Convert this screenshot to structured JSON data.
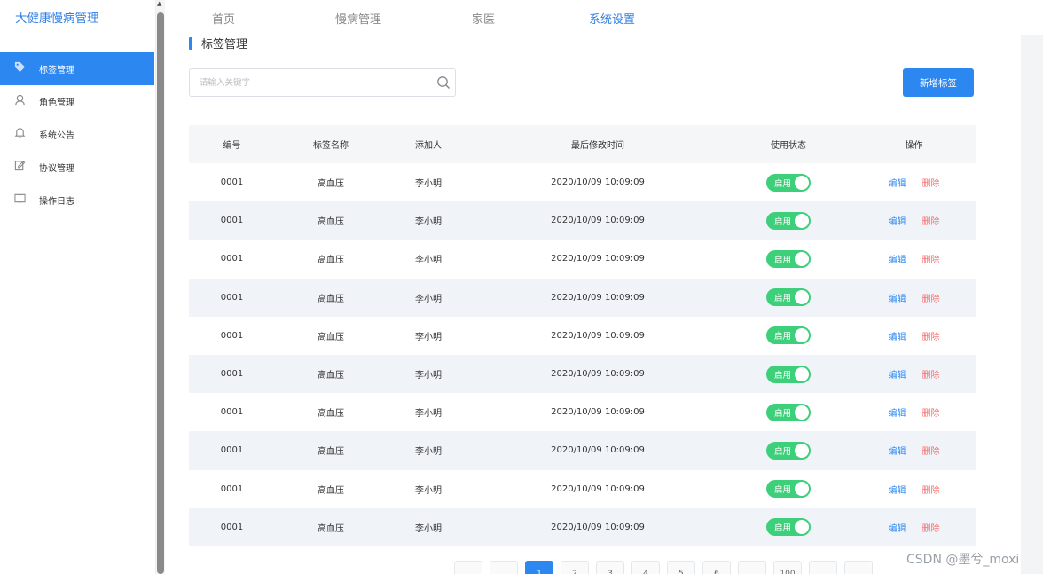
{
  "app": {
    "brand": "大健康慢病管理"
  },
  "topnav": [
    {
      "label": "首页"
    },
    {
      "label": "慢病管理"
    },
    {
      "label": "家医"
    },
    {
      "label": "系统设置",
      "active": true
    }
  ],
  "sidebar": {
    "items": [
      {
        "label": "标签管理",
        "icon": "tag-icon",
        "active": true
      },
      {
        "label": "角色管理",
        "icon": "user-icon"
      },
      {
        "label": "系统公告",
        "icon": "bell-icon"
      },
      {
        "label": "协议管理",
        "icon": "edit-document-icon"
      },
      {
        "label": "操作日志",
        "icon": "book-icon"
      }
    ]
  },
  "page": {
    "title": "标签管理",
    "search_placeholder": "请输入关键字",
    "add_button": "新增标签"
  },
  "table": {
    "headers": [
      "编号",
      "标签名称",
      "添加人",
      "最后修改时间",
      "使用状态",
      "操作"
    ],
    "rows": [
      {
        "id": "0001",
        "name": "高血压",
        "creator": "李小明",
        "modified": "2020/10/09 10:09:09",
        "status": "启用",
        "edit": "编辑",
        "delete": "删除"
      },
      {
        "id": "0001",
        "name": "高血压",
        "creator": "李小明",
        "modified": "2020/10/09 10:09:09",
        "status": "启用",
        "edit": "编辑",
        "delete": "删除"
      },
      {
        "id": "0001",
        "name": "高血压",
        "creator": "李小明",
        "modified": "2020/10/09 10:09:09",
        "status": "启用",
        "edit": "编辑",
        "delete": "删除"
      },
      {
        "id": "0001",
        "name": "高血压",
        "creator": "李小明",
        "modified": "2020/10/09 10:09:09",
        "status": "启用",
        "edit": "编辑",
        "delete": "删除"
      },
      {
        "id": "0001",
        "name": "高血压",
        "creator": "李小明",
        "modified": "2020/10/09 10:09:09",
        "status": "启用",
        "edit": "编辑",
        "delete": "删除"
      },
      {
        "id": "0001",
        "name": "高血压",
        "creator": "李小明",
        "modified": "2020/10/09 10:09:09",
        "status": "启用",
        "edit": "编辑",
        "delete": "删除"
      },
      {
        "id": "0001",
        "name": "高血压",
        "creator": "李小明",
        "modified": "2020/10/09 10:09:09",
        "status": "启用",
        "edit": "编辑",
        "delete": "删除"
      },
      {
        "id": "0001",
        "name": "高血压",
        "creator": "李小明",
        "modified": "2020/10/09 10:09:09",
        "status": "启用",
        "edit": "编辑",
        "delete": "删除"
      },
      {
        "id": "0001",
        "name": "高血压",
        "creator": "李小明",
        "modified": "2020/10/09 10:09:09",
        "status": "启用",
        "edit": "编辑",
        "delete": "删除"
      },
      {
        "id": "0001",
        "name": "高血压",
        "creator": "李小明",
        "modified": "2020/10/09 10:09:09",
        "status": "启用",
        "edit": "编辑",
        "delete": "删除"
      }
    ]
  },
  "pagination": {
    "pages": [
      "",
      "",
      "1",
      "2",
      "3",
      "4",
      "5",
      "6",
      "",
      "100",
      "",
      ""
    ],
    "current": "1"
  },
  "watermark": "CSDN @墨兮_moxi",
  "colors": {
    "accent": "#2d87f0",
    "toggle_on": "#3ecf7a",
    "danger": "#f56c6c",
    "row_alt": "#f0f4f9"
  }
}
